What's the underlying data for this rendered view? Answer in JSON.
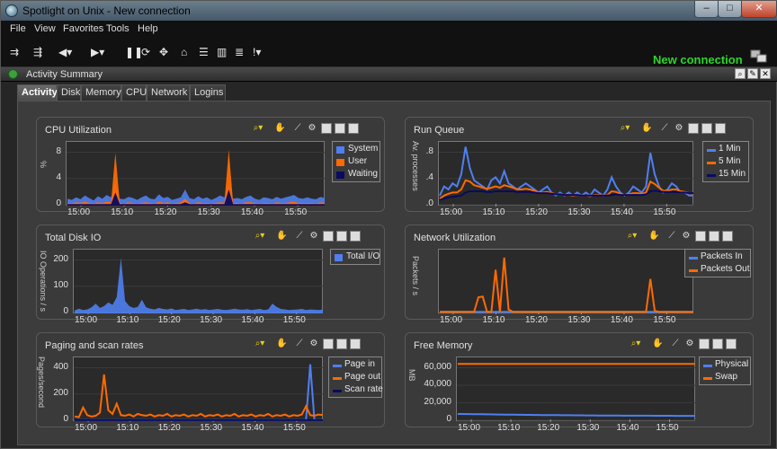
{
  "window": {
    "title": "Spotlight on Unix - New connection",
    "min_label": "–",
    "max_label": "□",
    "close_label": "✕"
  },
  "menubar": {
    "items": [
      {
        "label": "File"
      },
      {
        "label": "View"
      },
      {
        "label": "Favorites"
      },
      {
        "label": "Tools"
      },
      {
        "label": "Help"
      }
    ]
  },
  "toolbar": {
    "connection_label": "New connection",
    "icons": [
      "connect-icon",
      "disconnect-icon",
      "back-icon",
      "forward-icon",
      "pause-icon",
      "refresh-icon",
      "navigate-icon",
      "home-icon",
      "list-icon",
      "chart-icon",
      "database-icon",
      "alarm-icon"
    ]
  },
  "activity": {
    "title": "Activity Summary",
    "tabs": [
      {
        "label": "Activity",
        "active": true
      },
      {
        "label": "Disk",
        "active": false
      },
      {
        "label": "Memory",
        "active": false
      },
      {
        "label": "CPU",
        "active": false
      },
      {
        "label": "Network",
        "active": false
      },
      {
        "label": "Logins",
        "active": false
      }
    ]
  },
  "colors": {
    "blue": "#4f7ff0",
    "orange": "#ff6a00",
    "navy": "#0a0a60",
    "panel_bg": "#3a3a3a",
    "plot_bg": "#2a2a2a",
    "connection_green": "#2cd52c"
  },
  "chart_data": [
    {
      "id": "cpu",
      "title": "CPU Utilization",
      "type": "area",
      "ylabel": "%",
      "yticks": [
        "0",
        "4",
        "8"
      ],
      "xticks": [
        "15:00",
        "15:10",
        "15:20",
        "15:30",
        "15:40",
        "15:50"
      ],
      "ylim": [
        0,
        10
      ],
      "series": [
        {
          "name": "System",
          "color": "#4f7ff0",
          "values": [
            1.0,
            0.8,
            1.2,
            0.9,
            1.5,
            1.1,
            0.7,
            1.4,
            1.0,
            1.6,
            1.2,
            3.5,
            1.0,
            0.9,
            1.3,
            1.1,
            0.8,
            1.2,
            1.5,
            1.0,
            0.9,
            1.7,
            1.1,
            1.3,
            0.8,
            1.0,
            1.2,
            2.5,
            1.1,
            0.9,
            1.4,
            1.0,
            1.2,
            0.8,
            1.1,
            1.5,
            1.2,
            3.0,
            1.0,
            1.1,
            0.9,
            1.3,
            1.5,
            1.0,
            0.8,
            1.2,
            1.1,
            0.9,
            1.3,
            1.0,
            1.2,
            1.4,
            1.6,
            1.1,
            1.0,
            1.2,
            1.0,
            0.9,
            1.3,
            1.1
          ]
        },
        {
          "name": "User",
          "color": "#ff6a00",
          "values": [
            0.3,
            0.2,
            0.4,
            0.3,
            0.5,
            0.3,
            0.2,
            0.4,
            0.3,
            0.5,
            0.4,
            8.5,
            0.3,
            0.2,
            0.4,
            0.3,
            0.2,
            0.3,
            0.4,
            0.3,
            0.2,
            0.5,
            0.3,
            0.4,
            0.2,
            0.3,
            0.4,
            1.0,
            0.3,
            0.2,
            0.4,
            0.3,
            0.3,
            0.2,
            0.3,
            0.4,
            0.3,
            9.0,
            0.3,
            0.3,
            0.2,
            0.4,
            0.4,
            0.3,
            0.2,
            0.3,
            0.3,
            0.2,
            0.4,
            0.3,
            0.3,
            0.4,
            0.5,
            0.3,
            0.3,
            0.3,
            0.3,
            0.2,
            0.4,
            0.3
          ]
        },
        {
          "name": "Waiting",
          "color": "#0a0a60",
          "values": [
            0.1,
            0.1,
            0.1,
            0.1,
            0.1,
            0.1,
            0.1,
            0.1,
            0.1,
            0.1,
            0.1,
            2.0,
            0.1,
            0.1,
            0.1,
            0.1,
            0.1,
            0.1,
            0.1,
            0.1,
            0.1,
            0.1,
            0.1,
            0.1,
            0.1,
            0.1,
            0.1,
            0.4,
            0.1,
            0.1,
            0.1,
            0.1,
            0.1,
            0.1,
            0.1,
            0.1,
            0.1,
            2.5,
            0.1,
            0.1,
            0.1,
            0.1,
            0.1,
            0.1,
            0.1,
            0.1,
            0.1,
            0.1,
            0.1,
            0.1,
            0.1,
            0.1,
            0.1,
            0.1,
            0.1,
            0.1,
            0.1,
            0.1,
            0.1,
            0.1
          ]
        }
      ]
    },
    {
      "id": "runq",
      "title": "Run Queue",
      "type": "line",
      "ylabel": "Av. processes",
      "yticks": [
        ".0",
        ".4",
        ".8"
      ],
      "xticks": [
        "15:00",
        "15:10",
        "15:20",
        "15:30",
        "15:40",
        "15:50"
      ],
      "ylim": [
        0,
        1.0
      ],
      "series": [
        {
          "name": "1 Min",
          "color": "#4f7ff0",
          "values": [
            0.15,
            0.3,
            0.25,
            0.35,
            0.3,
            0.5,
            0.95,
            0.6,
            0.4,
            0.35,
            0.3,
            0.25,
            0.4,
            0.45,
            0.35,
            0.55,
            0.35,
            0.3,
            0.25,
            0.3,
            0.35,
            0.3,
            0.25,
            0.2,
            0.25,
            0.3,
            0.2,
            0.15,
            0.2,
            0.15,
            0.2,
            0.15,
            0.2,
            0.15,
            0.2,
            0.15,
            0.25,
            0.2,
            0.15,
            0.25,
            0.45,
            0.3,
            0.2,
            0.15,
            0.2,
            0.3,
            0.25,
            0.2,
            0.3,
            0.85,
            0.5,
            0.3,
            0.2,
            0.25,
            0.35,
            0.3,
            0.2,
            0.2,
            0.15,
            0.15
          ]
        },
        {
          "name": "5 Min",
          "color": "#ff6a00",
          "values": [
            0.1,
            0.15,
            0.18,
            0.2,
            0.2,
            0.25,
            0.4,
            0.38,
            0.32,
            0.3,
            0.28,
            0.26,
            0.28,
            0.3,
            0.28,
            0.32,
            0.3,
            0.28,
            0.25,
            0.25,
            0.26,
            0.25,
            0.23,
            0.2,
            0.2,
            0.21,
            0.19,
            0.17,
            0.17,
            0.16,
            0.16,
            0.15,
            0.16,
            0.15,
            0.15,
            0.14,
            0.16,
            0.16,
            0.15,
            0.16,
            0.22,
            0.21,
            0.18,
            0.16,
            0.17,
            0.19,
            0.19,
            0.18,
            0.2,
            0.38,
            0.34,
            0.28,
            0.23,
            0.23,
            0.25,
            0.25,
            0.22,
            0.21,
            0.19,
            0.18
          ]
        },
        {
          "name": "15 Min",
          "color": "#0a0a60",
          "values": [
            0.08,
            0.1,
            0.12,
            0.13,
            0.14,
            0.15,
            0.2,
            0.22,
            0.22,
            0.22,
            0.22,
            0.21,
            0.21,
            0.22,
            0.22,
            0.22,
            0.22,
            0.22,
            0.21,
            0.21,
            0.21,
            0.21,
            0.2,
            0.19,
            0.19,
            0.19,
            0.18,
            0.17,
            0.17,
            0.16,
            0.16,
            0.16,
            0.16,
            0.15,
            0.15,
            0.15,
            0.15,
            0.15,
            0.15,
            0.15,
            0.16,
            0.17,
            0.16,
            0.16,
            0.16,
            0.16,
            0.16,
            0.16,
            0.17,
            0.22,
            0.23,
            0.22,
            0.21,
            0.21,
            0.21,
            0.21,
            0.2,
            0.2,
            0.19,
            0.19
          ]
        }
      ]
    },
    {
      "id": "diskio",
      "title": "Total Disk IO",
      "type": "area",
      "ylabel": "IO Operations / s",
      "yticks": [
        "0",
        "100",
        "200"
      ],
      "xticks": [
        "15:00",
        "15:10",
        "15:20",
        "15:30",
        "15:40",
        "15:50"
      ],
      "ylim": [
        0,
        240
      ],
      "series": [
        {
          "name": "Total I/O",
          "color": "#4f7ff0",
          "values": [
            8,
            15,
            10,
            12,
            20,
            35,
            18,
            25,
            40,
            30,
            60,
            215,
            45,
            25,
            18,
            22,
            50,
            20,
            15,
            12,
            18,
            14,
            12,
            16,
            10,
            12,
            14,
            10,
            12,
            15,
            11,
            13,
            10,
            12,
            14,
            11,
            10,
            12,
            15,
            12,
            11,
            13,
            10,
            12,
            14,
            10,
            12,
            35,
            22,
            14,
            12,
            10,
            11,
            12,
            14,
            10,
            12,
            11,
            10,
            12
          ]
        }
      ]
    },
    {
      "id": "net",
      "title": "Network Utilization",
      "type": "line",
      "ylabel": "Packets / s",
      "yticks": [],
      "xticks": [
        "15:00",
        "15:10",
        "15:20",
        "15:30",
        "15:40",
        "15:50"
      ],
      "ylim": [
        0,
        100
      ],
      "series": [
        {
          "name": "Packets In",
          "color": "#4f7ff0",
          "values": [
            1,
            1,
            1,
            1,
            1,
            1,
            1,
            1,
            1,
            1,
            1,
            1,
            1,
            1,
            1,
            1,
            1,
            1,
            1,
            1,
            1,
            1,
            1,
            1,
            1,
            1,
            1,
            1,
            1,
            1,
            1,
            1,
            1,
            1,
            1,
            1,
            1,
            1,
            1,
            1,
            1,
            1,
            1,
            1,
            1,
            1,
            1,
            1,
            1,
            1,
            1,
            1,
            1,
            1,
            1,
            1,
            1,
            1,
            1,
            1
          ]
        },
        {
          "name": "Packets Out",
          "color": "#ff6a00",
          "values": [
            1,
            1,
            1,
            1,
            1,
            1,
            1,
            1,
            1,
            25,
            26,
            1,
            1,
            70,
            1,
            90,
            5,
            1,
            1,
            1,
            1,
            1,
            1,
            1,
            1,
            1,
            1,
            1,
            1,
            1,
            1,
            1,
            1,
            1,
            1,
            1,
            1,
            1,
            1,
            1,
            1,
            1,
            1,
            1,
            1,
            1,
            1,
            1,
            1,
            55,
            3,
            1,
            1,
            1,
            1,
            1,
            1,
            1,
            1,
            1
          ]
        }
      ]
    },
    {
      "id": "paging",
      "title": "Paging and scan rates",
      "type": "line",
      "ylabel": "Pages/second",
      "yticks": [
        "0",
        "200",
        "400"
      ],
      "xticks": [
        "15:00",
        "15:10",
        "15:20",
        "15:30",
        "15:40",
        "15:50"
      ],
      "ylim": [
        0,
        480
      ],
      "series": [
        {
          "name": "Page in",
          "color": "#4f7ff0",
          "values": [
            2,
            2,
            2,
            2,
            2,
            2,
            2,
            2,
            2,
            2,
            2,
            2,
            2,
            2,
            2,
            2,
            2,
            2,
            2,
            2,
            2,
            2,
            2,
            2,
            2,
            2,
            2,
            2,
            2,
            2,
            2,
            2,
            2,
            2,
            2,
            2,
            2,
            2,
            2,
            2,
            2,
            2,
            2,
            2,
            2,
            2,
            2,
            2,
            2,
            2,
            2,
            2,
            2,
            2,
            2,
            2,
            440,
            2,
            2,
            2
          ]
        },
        {
          "name": "Page out",
          "color": "#ff6a00",
          "values": [
            30,
            25,
            100,
            40,
            30,
            35,
            60,
            360,
            80,
            50,
            130,
            40,
            35,
            45,
            30,
            50,
            40,
            35,
            45,
            30,
            40,
            35,
            50,
            30,
            40,
            35,
            45,
            30,
            40,
            35,
            50,
            30,
            40,
            35,
            45,
            30,
            40,
            35,
            50,
            30,
            40,
            35,
            45,
            30,
            40,
            35,
            50,
            30,
            40,
            35,
            45,
            30,
            40,
            35,
            45,
            110,
            40,
            35,
            45,
            40
          ]
        },
        {
          "name": "Scan rate",
          "color": "#0a0a60",
          "values": [
            1,
            1,
            1,
            1,
            1,
            1,
            1,
            1,
            1,
            1,
            1,
            1,
            1,
            1,
            1,
            1,
            1,
            1,
            1,
            1,
            1,
            1,
            1,
            1,
            1,
            1,
            1,
            1,
            1,
            1,
            1,
            1,
            1,
            1,
            1,
            1,
            1,
            1,
            1,
            1,
            1,
            1,
            1,
            1,
            1,
            1,
            1,
            1,
            1,
            1,
            1,
            1,
            1,
            1,
            1,
            1,
            1,
            1,
            1,
            1
          ]
        }
      ]
    },
    {
      "id": "mem",
      "title": "Free Memory",
      "type": "line",
      "ylabel": "MB",
      "yticks": [
        "0",
        "20,000",
        "40,000",
        "60,000"
      ],
      "xticks": [
        "15:00",
        "15:10",
        "15:20",
        "15:30",
        "15:40",
        "15:50"
      ],
      "ylim": [
        0,
        70000
      ],
      "series": [
        {
          "name": "Physical",
          "color": "#4f7ff0",
          "values": [
            7200,
            7200,
            7100,
            7100,
            7000,
            6900,
            6900,
            6800,
            6800,
            6700,
            6600,
            6600,
            6500,
            6500,
            6400,
            6300,
            6300,
            6200,
            6200,
            6100,
            6100,
            6000,
            6000,
            6000,
            5900,
            5900,
            5800,
            5800,
            5800,
            5700,
            5700,
            5700,
            5600,
            5600,
            5600,
            5500,
            5500,
            5500,
            5400,
            5400,
            5400,
            5300,
            5300,
            5300,
            5300,
            5200,
            5200,
            5200,
            5200,
            5100,
            5100,
            5100,
            5100,
            5100,
            5000,
            5000,
            5000,
            5000,
            5000,
            5000
          ]
        },
        {
          "name": "Swap",
          "color": "#ff6a00",
          "values": [
            64500,
            64500,
            64500,
            64500,
            64500,
            64500,
            64500,
            64500,
            64500,
            64500,
            64500,
            64500,
            64500,
            64500,
            64500,
            64500,
            64500,
            64500,
            64500,
            64500,
            64500,
            64500,
            64500,
            64500,
            64500,
            64500,
            64500,
            64500,
            64500,
            64500,
            64500,
            64500,
            64500,
            64500,
            64500,
            64500,
            64500,
            64500,
            64500,
            64500,
            64500,
            64500,
            64500,
            64500,
            64500,
            64500,
            64500,
            64500,
            64500,
            64500,
            64500,
            64500,
            64500,
            64500,
            64500,
            64500,
            64500,
            64500,
            64500,
            64500
          ]
        }
      ]
    }
  ]
}
